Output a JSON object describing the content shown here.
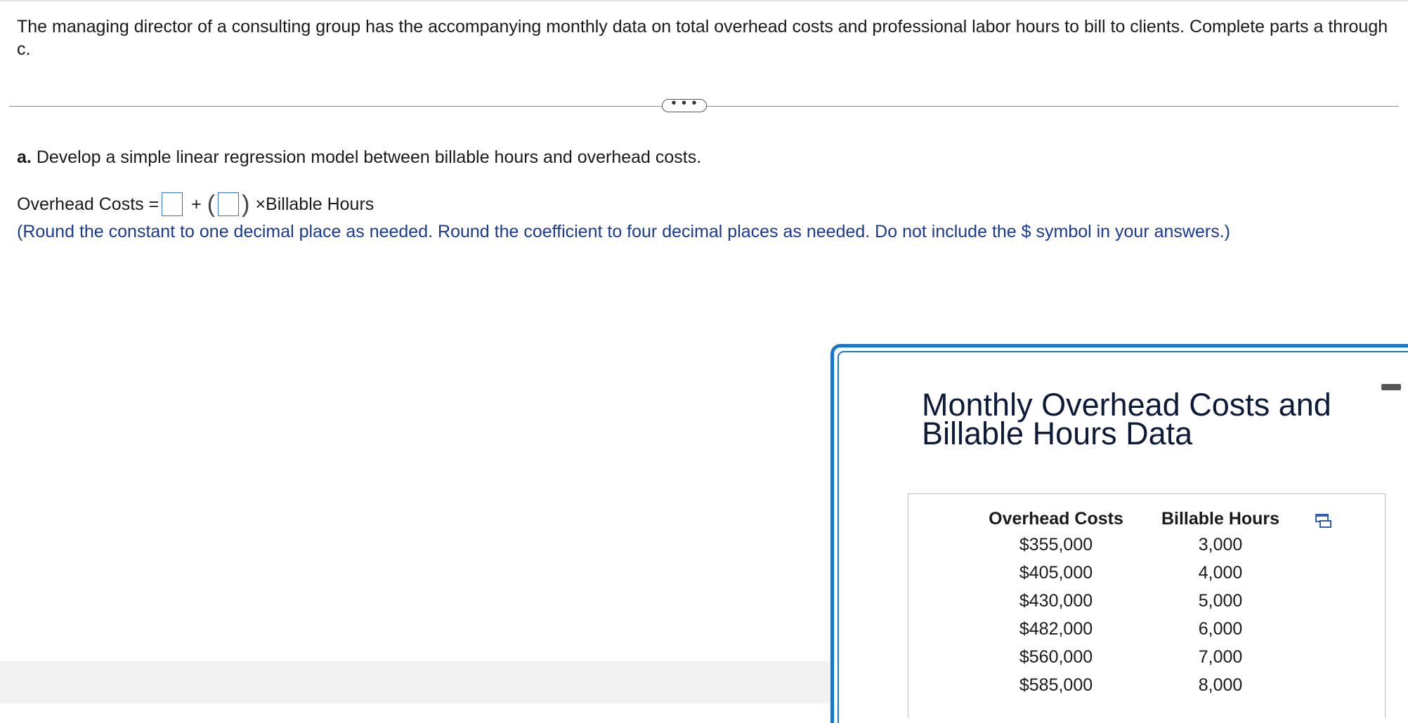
{
  "question": {
    "intro": "The managing director of a consulting group has the accompanying monthly data on total overhead costs and professional labor hours to bill to clients. Complete parts a through c."
  },
  "more_button": {
    "label": "• • •"
  },
  "part_a": {
    "letter": "a.",
    "prompt": "Develop a simple linear regression model between billable hours and overhead costs.",
    "equation": {
      "lhs": "Overhead Costs =",
      "plus": "+",
      "open_paren": "(",
      "close_paren": ")",
      "times_label": "×Billable Hours"
    },
    "hint": "(Round the constant to one decimal place as needed. Round the coefficient to four decimal places as needed. Do not include the $ symbol in your answers.)"
  },
  "data_panel": {
    "title": "Monthly Overhead Costs and Billable Hours Data",
    "columns": [
      "Overhead Costs",
      "Billable Hours"
    ],
    "rows": [
      [
        "$355,000",
        "3,000"
      ],
      [
        "$405,000",
        "4,000"
      ],
      [
        "$430,000",
        "5,000"
      ],
      [
        "$482,000",
        "6,000"
      ],
      [
        "$560,000",
        "7,000"
      ],
      [
        "$585,000",
        "8,000"
      ]
    ],
    "copy_icon": "copy-icon",
    "minimize_icon": "minimize-icon"
  }
}
